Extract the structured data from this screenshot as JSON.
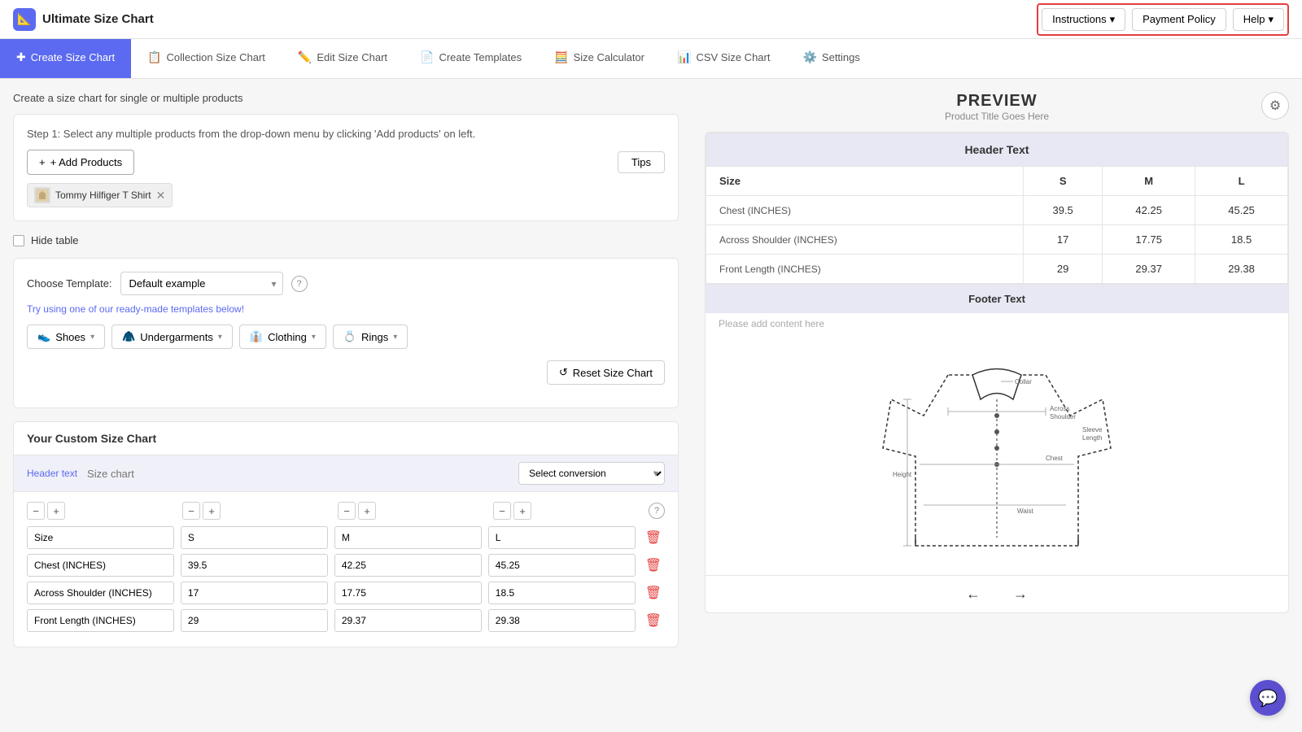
{
  "app": {
    "title": "Ultimate Size Chart",
    "logo_icon": "📐"
  },
  "top_actions": {
    "instructions": "Instructions",
    "payment_policy": "Payment Policy",
    "help": "Help"
  },
  "nav_tabs": [
    {
      "id": "create-size-chart",
      "label": "Create Size Chart",
      "icon": "✚",
      "active": true
    },
    {
      "id": "collection-size-chart",
      "label": "Collection Size Chart",
      "icon": "📋",
      "active": false
    },
    {
      "id": "edit-size-chart",
      "label": "Edit Size Chart",
      "icon": "✏️",
      "active": false
    },
    {
      "id": "create-templates",
      "label": "Create Templates",
      "icon": "📄",
      "active": false
    },
    {
      "id": "size-calculator",
      "label": "Size Calculator",
      "icon": "🧮",
      "active": false
    },
    {
      "id": "csv-size-chart",
      "label": "CSV Size Chart",
      "icon": "📊",
      "active": false
    },
    {
      "id": "settings",
      "label": "Settings",
      "icon": "⚙️",
      "active": false
    }
  ],
  "page": {
    "section_title": "Create a size chart for single or multiple products",
    "step1_text": "Step 1: Select any multiple products from the drop-down menu by clicking 'Add products' on left.",
    "add_products_label": "+ Add Products",
    "tips_label": "Tips",
    "product_tag": "Tommy Hilfiger T Shirt",
    "hide_table_label": "Hide table",
    "choose_template_label": "Choose Template:",
    "template_default": "Default example",
    "template_hint": "Try using one of our ready-made templates below!",
    "categories": [
      {
        "icon": "👟",
        "label": "Shoes",
        "id": "shoes"
      },
      {
        "icon": "🧥",
        "label": "Undergarments",
        "id": "undergarments"
      },
      {
        "icon": "👔",
        "label": "Clothing",
        "id": "clothing"
      },
      {
        "icon": "💍",
        "label": "Rings",
        "id": "rings"
      }
    ],
    "reset_label": "Reset Size Chart",
    "chart_section_title": "Your Custom Size Chart",
    "header_text_label": "Header text",
    "header_text_placeholder": "Size chart",
    "conversion_placeholder": "Select conversion",
    "col_controls": [
      "−",
      "+",
      "−",
      "+",
      "−",
      "+",
      "−",
      "+"
    ],
    "table_rows": [
      {
        "cols": [
          "Size",
          "S",
          "M",
          "L"
        ]
      },
      {
        "cols": [
          "Chest (INCHES)",
          "39.5",
          "42.25",
          "45.25"
        ]
      },
      {
        "cols": [
          "Across Shoulder (INCHES)",
          "17",
          "17.75",
          "18.5"
        ]
      },
      {
        "cols": [
          "Front Length (INCHES)",
          "29",
          "29.37",
          "29.38"
        ]
      }
    ]
  },
  "preview": {
    "title": "PREVIEW",
    "subtitle": "Product Title Goes Here",
    "header_text": "Header Text",
    "size_col": "Size",
    "size_options": [
      "S",
      "M",
      "L"
    ],
    "table_rows": [
      {
        "label": "Chest (INCHES)",
        "values": [
          "39.5",
          "42.25",
          "45.25"
        ]
      },
      {
        "label": "Across Shoulder (INCHES)",
        "values": [
          "17",
          "17.75",
          "18.5"
        ]
      },
      {
        "label": "Front Length (INCHES)",
        "values": [
          "29",
          "29.37",
          "29.38"
        ]
      }
    ],
    "footer_text": "Footer Text",
    "footer_note": "Please add content here"
  }
}
